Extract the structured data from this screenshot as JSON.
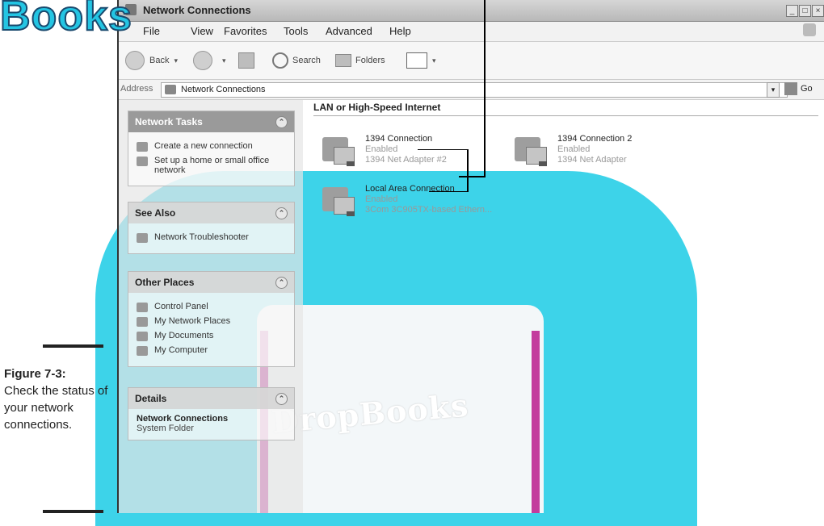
{
  "watermark": {
    "top_text": "Books",
    "book_text": "DropBooks"
  },
  "caption": {
    "title": "Figure 7-3:",
    "text": "Check the status of your network connections."
  },
  "window": {
    "title": "Network Connections",
    "controls": [
      "_",
      "□",
      "×"
    ],
    "menu": [
      "File",
      "View",
      "Favorites",
      "Tools",
      "Advanced",
      "Help"
    ],
    "toolbar": {
      "back": "Back",
      "search": "Search",
      "folders": "Folders"
    },
    "address": {
      "label": "Address",
      "value": "Network Connections",
      "go": "Go"
    }
  },
  "sidebar": {
    "network_tasks": {
      "title": "Network Tasks",
      "items": [
        "Create a new connection",
        "Set up a home or small office network"
      ]
    },
    "see_also": {
      "title": "See Also",
      "items": [
        "Network Troubleshooter"
      ]
    },
    "other_places": {
      "title": "Other Places",
      "items": [
        "Control Panel",
        "My Network Places",
        "My Documents",
        "My Computer"
      ]
    },
    "details": {
      "title": "Details",
      "name": "Network Connections",
      "type": "System Folder"
    }
  },
  "content": {
    "group_title": "LAN or High-Speed Internet",
    "connections": [
      {
        "name": "1394 Connection",
        "status": "Enabled",
        "device": "1394 Net Adapter #2"
      },
      {
        "name": "1394 Connection 2",
        "status": "Enabled",
        "device": "1394 Net Adapter"
      },
      {
        "name": "Local Area Connection",
        "status": "Enabled",
        "device": "3Com 3C905TX-based Ethern..."
      }
    ]
  }
}
